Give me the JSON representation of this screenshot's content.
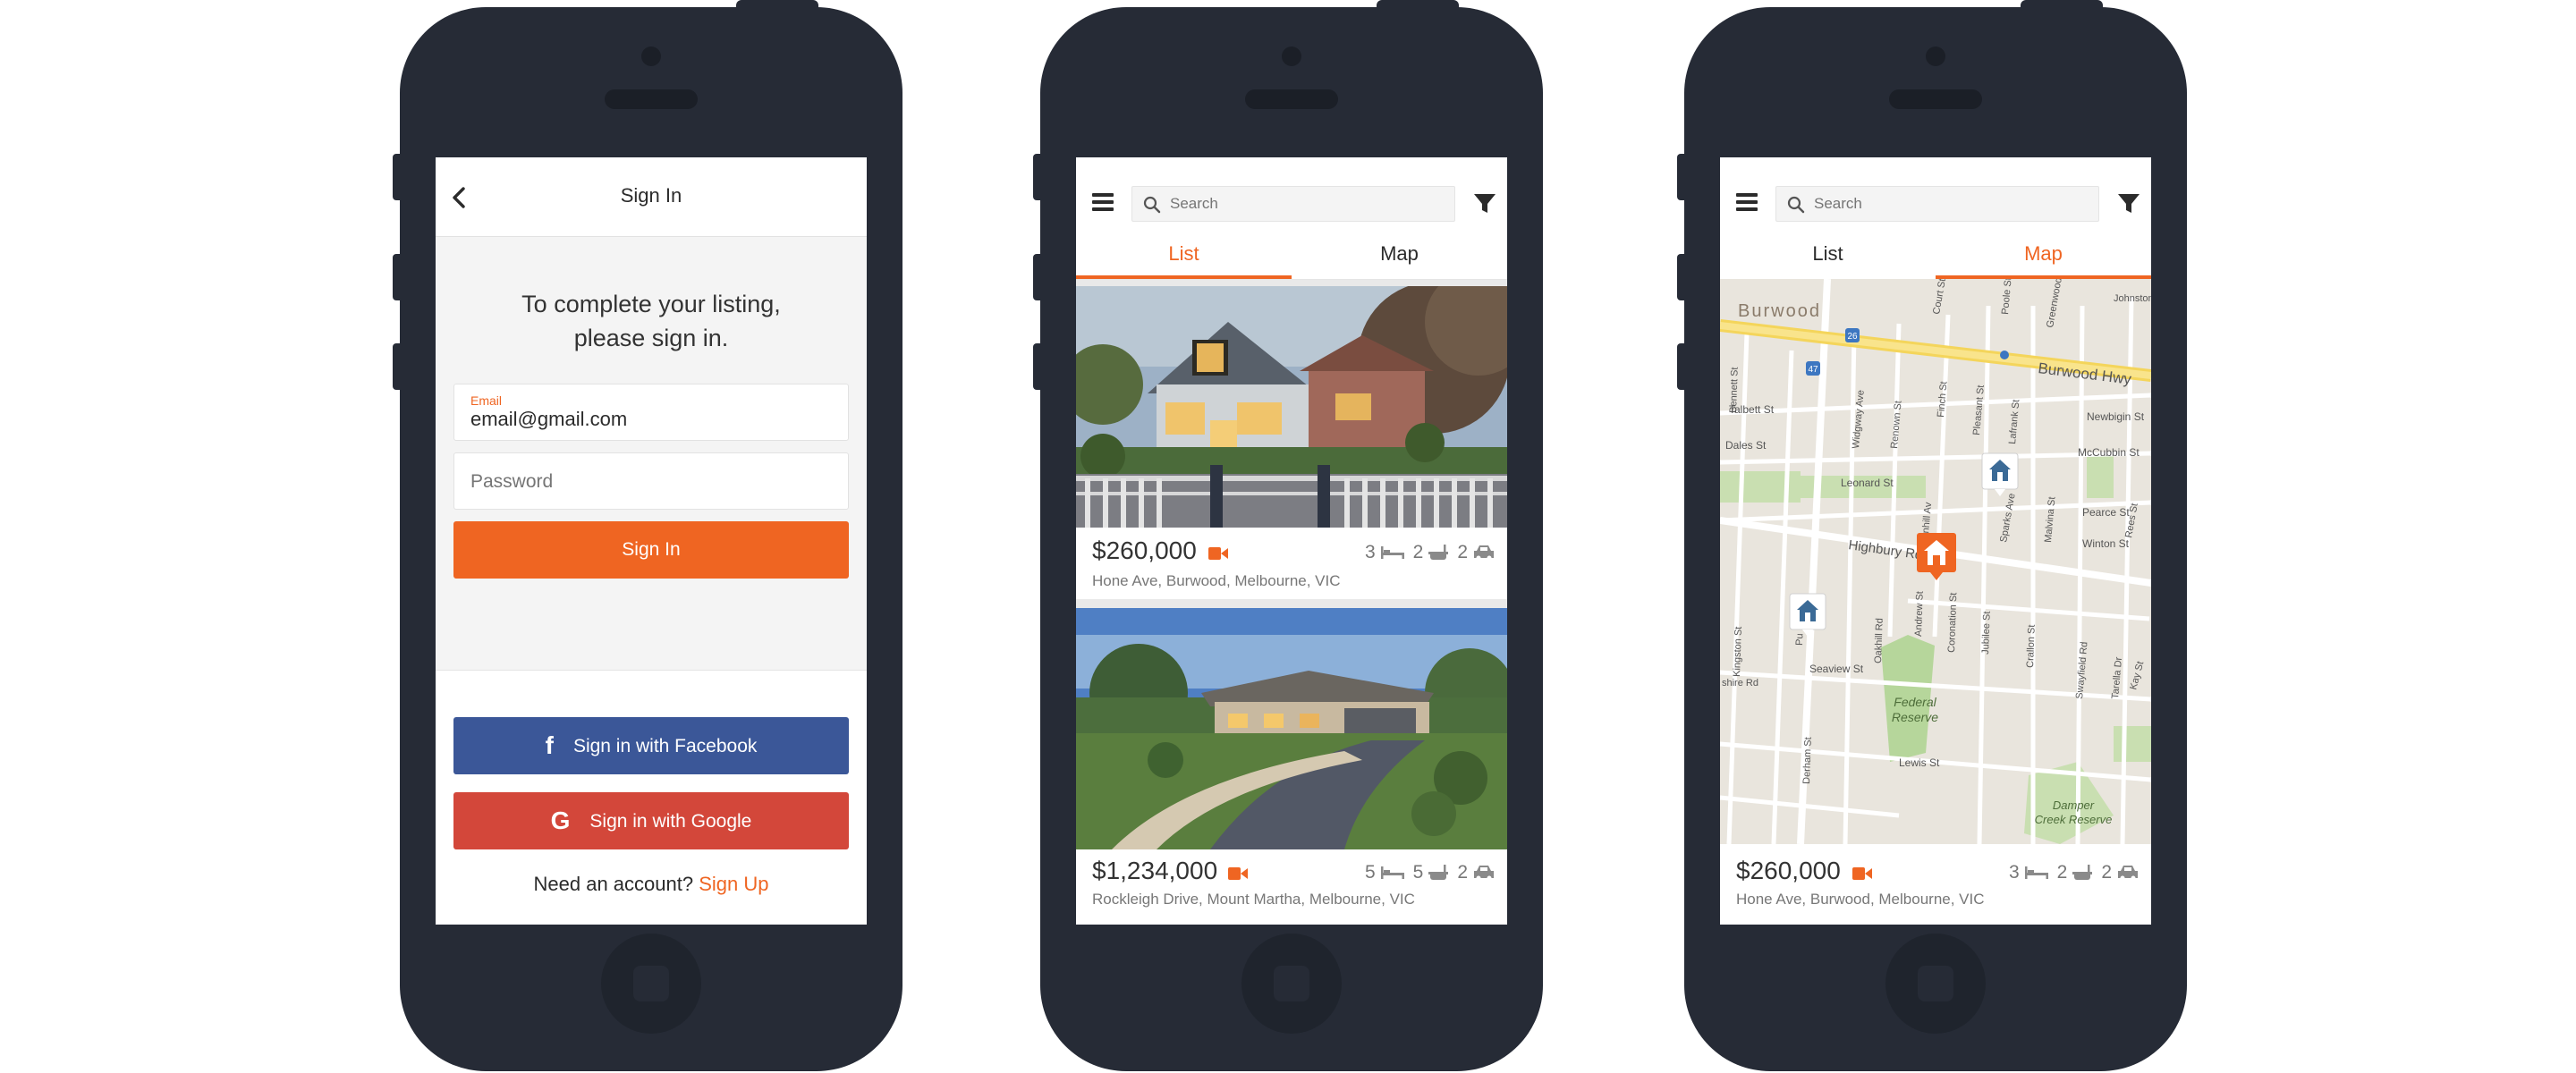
{
  "signin": {
    "title": "Sign In",
    "message_line1": "To complete your listing,",
    "message_line2": "please sign in.",
    "email_label": "Email",
    "email_value": "email@gmail.com",
    "password_placeholder": "Password",
    "signin_button": "Sign In",
    "facebook_button": "Sign in with Facebook",
    "google_button": "Sign in with Google",
    "footer_prompt": "Need an account?",
    "footer_link": "Sign Up"
  },
  "search": {
    "placeholder": "Search"
  },
  "tabs": {
    "list": "List",
    "map": "Map"
  },
  "listings": [
    {
      "price": "$260,000",
      "address": "Hone Ave, Burwood, Melbourne, VIC",
      "beds": "3",
      "baths": "2",
      "cars": "2"
    },
    {
      "price": "$1,234,000",
      "address": "Rockleigh Drive, Mount Martha, Melbourne, VIC",
      "beds": "5",
      "baths": "5",
      "cars": "2"
    }
  ],
  "map": {
    "labels": {
      "burwood": "Burwood",
      "burwood_hwy": "Burwood Hwy",
      "highbury": "Highbury Rd",
      "federal": "Federal",
      "reserve": "Reserve",
      "damper": "Damper",
      "creek_reserve": "Creek Reserve",
      "route1": "26",
      "route2": "47",
      "talbett": "Talbett St",
      "leonard": "Leonard St",
      "mccubbin": "McCubbin St",
      "newbigin": "Newbigin St",
      "pearce": "Pearce St",
      "winton": "Winton St",
      "seaview": "Seaview St",
      "lewis": "Lewis St",
      "widgway": "Widgway Ave",
      "renown": "Renown St",
      "finch": "Finch St",
      "pleasant": "Pleasant St",
      "lafrank": "Lafrank St",
      "sunhill": "Sunhill Av",
      "sparks": "Sparks Ave",
      "malvina": "Malvina St",
      "oakhill": "Oakhill Rd",
      "andrew": "Andrew St",
      "coronation": "Coronation St",
      "jubilee": "Jubilee St",
      "crallon": "Crallon St",
      "swayfield": "Swayfield Rd",
      "tarella": "Tarella Dr",
      "kingston": "Kingston St",
      "derham": "Derham St",
      "poole": "Poole St",
      "greenwood": "Greenwood",
      "johnston": "Johnston",
      "court": "Court St",
      "bennett": "Bennett St",
      "dales": "Dales St",
      "shire": "shire Rd",
      "rees": "Rees St",
      "kay": "Kay St",
      "pu": "Pu"
    }
  }
}
